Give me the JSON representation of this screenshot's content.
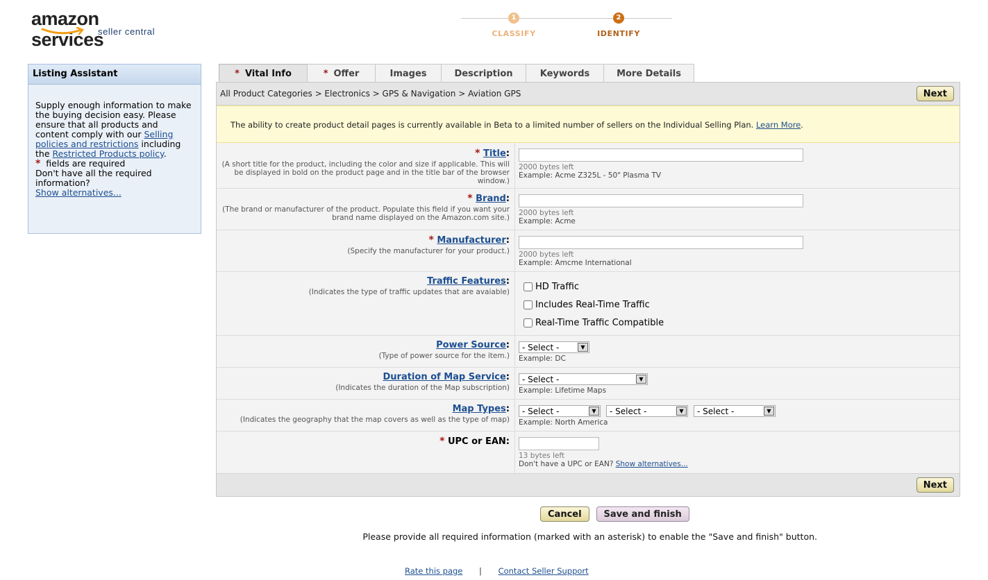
{
  "header": {
    "logo_main": "amazon services",
    "logo_sub": "seller central",
    "steps": [
      {
        "number": "1",
        "label": "CLASSIFY"
      },
      {
        "number": "2",
        "label": "IDENTIFY"
      }
    ]
  },
  "sidebar": {
    "title": "Listing Assistant",
    "intro_before_link": "Supply enough information to make the buying decision easy. Please ensure that all products and content comply with our ",
    "link_policies": "Selling policies and restrictions",
    "intro_middle": " including the ",
    "link_restricted": "Restricted Products policy",
    "intro_end": ".",
    "asterisk": "*",
    "required_note": "fields are required",
    "missing_text": "Don't have all the required information?",
    "link_alternatives": "Show alternatives..."
  },
  "tabs": [
    {
      "label": "Vital Info",
      "required": true,
      "active": true
    },
    {
      "label": "Offer",
      "required": true,
      "active": false
    },
    {
      "label": "Images",
      "required": false,
      "active": false
    },
    {
      "label": "Description",
      "required": false,
      "active": false
    },
    {
      "label": "Keywords",
      "required": false,
      "active": false
    },
    {
      "label": "More Details",
      "required": false,
      "active": false
    }
  ],
  "breadcrumb": "All Product Categories > Electronics > GPS & Navigation > Aviation GPS",
  "next_label": "Next",
  "notice": {
    "text": "The ability to create product detail pages is currently available in Beta to a limited number of sellers on the Individual Selling Plan. ",
    "link": "Learn More",
    "end": "."
  },
  "fields": {
    "title": {
      "label": "Title",
      "desc": "(A short title for the product, including the color and size if applicable. This will be displayed in bold on the product page and in the title bar of the browser window.)",
      "hint": "2000 bytes left",
      "example": "Example: Acme Z325L - 50\" Plasma TV",
      "value": ""
    },
    "brand": {
      "label": "Brand",
      "desc": "(The brand or manufacturer of the product. Populate this field if you want your brand name displayed on the Amazon.com site.)",
      "hint": "2000 bytes left",
      "example": "Example: Acme",
      "value": ""
    },
    "manufacturer": {
      "label": "Manufacturer",
      "desc": "(Specify the manufacturer for your product.)",
      "hint": "2000 bytes left",
      "example": "Example: Amcme International",
      "value": ""
    },
    "traffic": {
      "label": "Traffic Features",
      "desc": "(Indicates the type of traffic updates that are avaiable)",
      "options": [
        "HD Traffic",
        "Includes Real-Time Traffic",
        "Real-Time Traffic Compatible"
      ]
    },
    "power": {
      "label": "Power Source",
      "desc": "(Type of power source for the item.)",
      "selected": "- Select -",
      "example": "Example: DC"
    },
    "duration": {
      "label": "Duration of Map Service",
      "desc": "(Indicates the duration of the Map subscription)",
      "selected": "- Select -",
      "example": "Example: Lifetime Maps"
    },
    "maptypes": {
      "label": "Map Types",
      "desc": "(Indicates the geography that the map covers as well as the type of map)",
      "selects": [
        "- Select -",
        "- Select -",
        "- Select -"
      ],
      "example": "Example: North America"
    },
    "upc": {
      "label": "UPC or EAN",
      "hint": "13 bytes left",
      "missing": "Don't have a UPC or EAN? ",
      "link": "Show alternatives...",
      "value": ""
    }
  },
  "colon": ":",
  "actions": {
    "cancel": "Cancel",
    "save": "Save and finish",
    "info": "Please provide all required information (marked with an asterisk) to enable the \"Save and finish\" button."
  },
  "footer": {
    "rate": "Rate this page",
    "separator": "|",
    "contact": "Contact Seller Support"
  }
}
